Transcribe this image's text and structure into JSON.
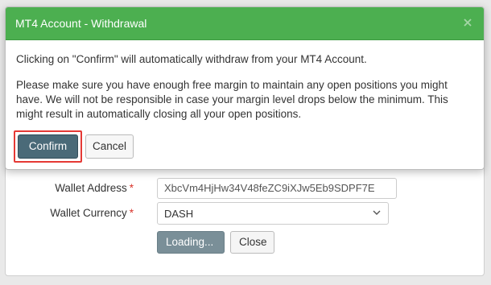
{
  "modal": {
    "title": "MT4 Account - Withdrawal",
    "close_symbol": "×",
    "message1": "Clicking on \"Confirm\" will automatically withdraw from your MT4 Account.",
    "message2": "Please make sure you have enough free margin to maintain any open positions you might have. We will not be responsible in case your margin level drops below the minimum. This might result in automatically closing all your open positions.",
    "confirm_label": "Confirm",
    "cancel_label": "Cancel"
  },
  "form": {
    "wallet_address_label": "Wallet Address",
    "wallet_address_value": "XbcVm4HjHw34V48feZC9iXJw5Eb9SDPF7E",
    "wallet_currency_label": "Wallet Currency",
    "wallet_currency_value": "DASH",
    "required_mark": "*",
    "loading_label": "Loading...",
    "close_label": "Close"
  },
  "colors": {
    "header_green": "#4caf50",
    "confirm_bg": "#4a6a78",
    "highlight_red": "#e53935"
  }
}
